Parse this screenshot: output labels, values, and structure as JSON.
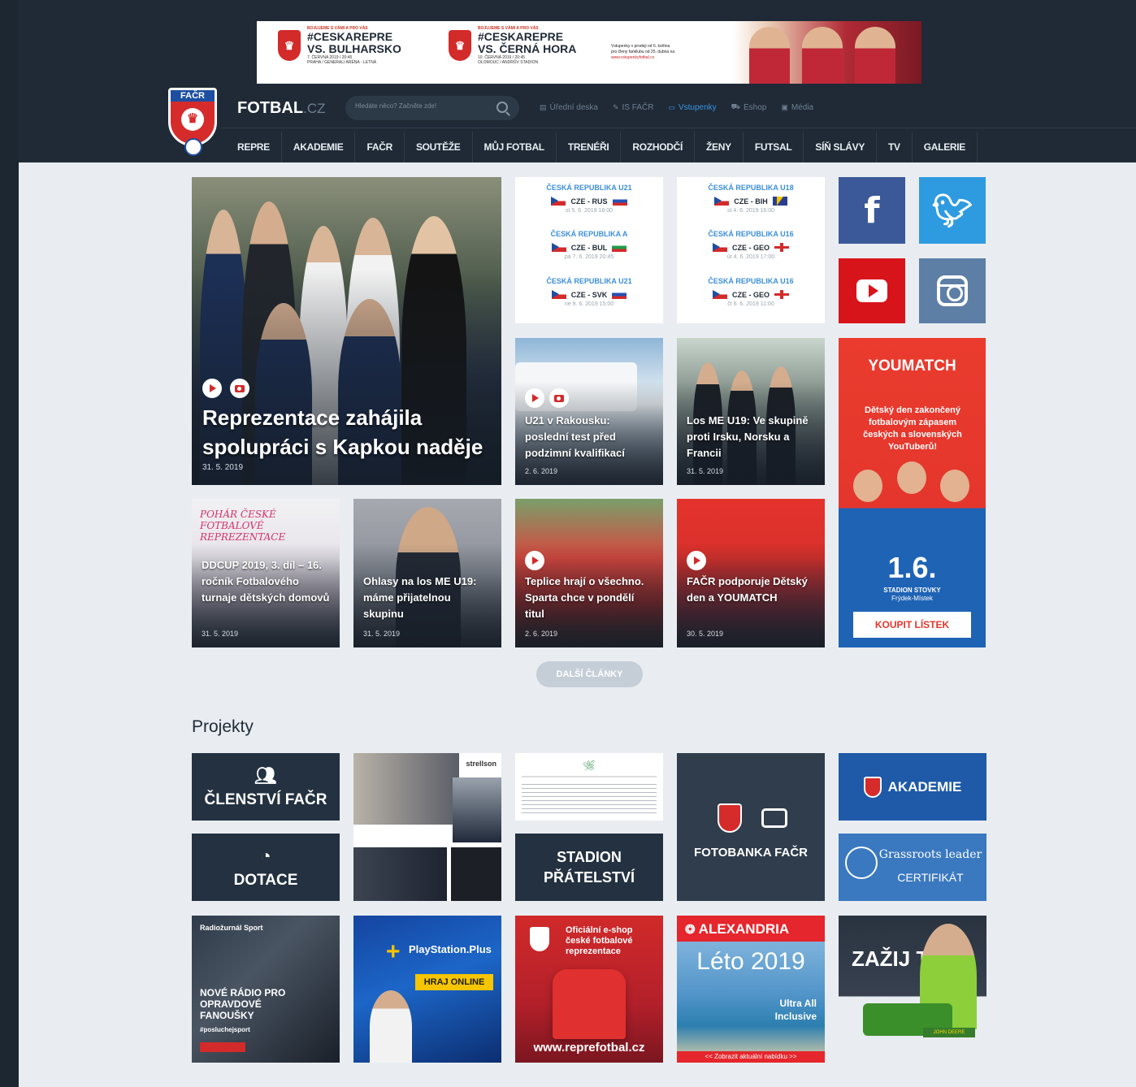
{
  "banner": {
    "match1_small": "BOJUJEME S VÁMI A PRO VÁS",
    "match1_tag": "#CESKAREPRE",
    "match1_vs": "VS. BULHARSKO",
    "match1_date": "7. ČERVNA 2019 / 20:45",
    "match1_place": "PRAHA / GENERALI ARÉNA - LETNÁ",
    "match2_small": "BOJUJEME S VÁMI A PRO VÁS",
    "match2_tag": "#CESKAREPRE",
    "match2_vs": "VS. ČERNÁ HORA",
    "match2_date": "10. ČERVNA 2019 / 20:45",
    "match2_place": "OLOMOUC / ANDRŮV STADION",
    "info_line1": "Vstupenky v prodeji od 6. května",
    "info_line2": "pro členy fanklubu od 25. dubna na",
    "info_link": "www.vstupenkyfotbal.cz"
  },
  "header": {
    "site_name": "FOTBAL",
    "site_tld": ".CZ",
    "search_placeholder": "Hledáte něco? Začněte zde!",
    "top_links": [
      {
        "label": "Úřední deska",
        "icon": "board-icon"
      },
      {
        "label": "IS FAČR",
        "icon": "pen-icon"
      },
      {
        "label": "Vstupenky",
        "icon": "ticket-icon"
      },
      {
        "label": "Eshop",
        "icon": "cart-icon"
      },
      {
        "label": "Média",
        "icon": "image-icon"
      }
    ],
    "nav": [
      "REPRE",
      "AKADEMIE",
      "FAČR",
      "SOUTĚŽE",
      "MŮJ FOTBAL",
      "TRENÉŘI",
      "ROZHODČÍ",
      "ŽENY",
      "FUTSAL",
      "SÍŇ SLÁVY",
      "TV",
      "GALERIE"
    ]
  },
  "featured": {
    "title": "Reprezentace zahájila spolupráci s Kapkou naděje",
    "date": "31. 5. 2019"
  },
  "matches_left": [
    {
      "team": "ČESKÁ REPUBLIKA U21",
      "home": "CZE",
      "away": "RUS",
      "date": "st 5. 6. 2019 18:00"
    },
    {
      "team": "ČESKÁ REPUBLIKA A",
      "home": "CZE",
      "away": "BUL",
      "date": "pá 7. 6. 2019 20:45"
    },
    {
      "team": "ČESKÁ REPUBLIKA U21",
      "home": "CZE",
      "away": "SVK",
      "date": "ne 9. 6. 2019 15:00"
    }
  ],
  "matches_right": [
    {
      "team": "ČESKÁ REPUBLIKA U18",
      "home": "CZE",
      "away": "BIH",
      "date": "st 4. 6. 2019 16:00"
    },
    {
      "team": "ČESKÁ REPUBLIKA U16",
      "home": "CZE",
      "away": "GEO",
      "date": "út 4. 6. 2019 17:00"
    },
    {
      "team": "ČESKÁ REPUBLIKA U16",
      "home": "CZE",
      "away": "GEO",
      "date": "čt 6. 6. 2019 11:00"
    }
  ],
  "articles": [
    {
      "title": "U21 v Rakousku: poslední test před podzimní kvalifikací",
      "date": "2. 6. 2019"
    },
    {
      "title": "Los ME U19: Ve skupině proti Irsku, Norsku a Francii",
      "date": "31. 5. 2019"
    },
    {
      "title": "DDCUP 2019, 3. díl – 16. ročník Fotbalového turnaje dětských domovů",
      "date": "31. 5. 2019"
    },
    {
      "title": "Ohlasy na los ME U19: máme přijatelnou skupinu",
      "date": "31. 5. 2019"
    },
    {
      "title": "Teplice hrají o všechno. Sparta chce v pondělí titul",
      "date": "2. 6. 2019"
    },
    {
      "title": "FAČR podporuje Dětský den a YOUMATCH",
      "date": "30. 5. 2019"
    }
  ],
  "ddcup_overlay": "POHÁR ČESKÉ FOTBALOVÉ REPREZENTACE",
  "youmatch": {
    "logo": "YOUMATCH",
    "desc": "Dětský den zakončený fotbalovým zápasem českých a slovenských YouTuberů!",
    "date": "1.6.",
    "place1": "STADION STOVKY",
    "place2": "Frýdek-Místek",
    "button": "KOUPIT LÍSTEK"
  },
  "more_button": "DALŠÍ ČLÁNKY",
  "projects_title": "Projekty",
  "projects": {
    "clenstvi": "ČLENSTVÍ FAČR",
    "dotace": "DOTACE",
    "stadion1": "STADION",
    "stadion2": "PŘÁTELSTVÍ",
    "fotobanka": "FOTOBANKA FAČR",
    "akademie": "AKADEMIE",
    "grass1": "Grassroots leader",
    "grass2": "CERTIFIKÁT",
    "radio": "NOVÉ RÁDIO PRO OPRAVDOVÉ FANOUŠKY",
    "radio_tag": "#posluchejsport",
    "radio_brand": "Radiožurnál Sport",
    "ps_brand": "PlayStation.Plus",
    "ps_button": "HRAJ ONLINE",
    "eshop_title": "Oficiální e-shop české fotbalové reprezentace",
    "eshop_url": "www.reprefotbal.cz",
    "alex_brand": "ALEXANDRIA",
    "alex_title": "Léto 2019",
    "alex_sub": "Ultra All Inclusive",
    "alex_link": "<< Zobrazit aktuální nabídku >>",
    "deere": "ZAŽIJ TO",
    "deere_brand": "JOHN DEERE",
    "suit_brand": "strellson"
  },
  "colors": {
    "header_bg": "#1f2a36",
    "page_bg": "#e9edf1",
    "accent_blue": "#3c8fd8",
    "brand_red": "#d62b2b"
  }
}
